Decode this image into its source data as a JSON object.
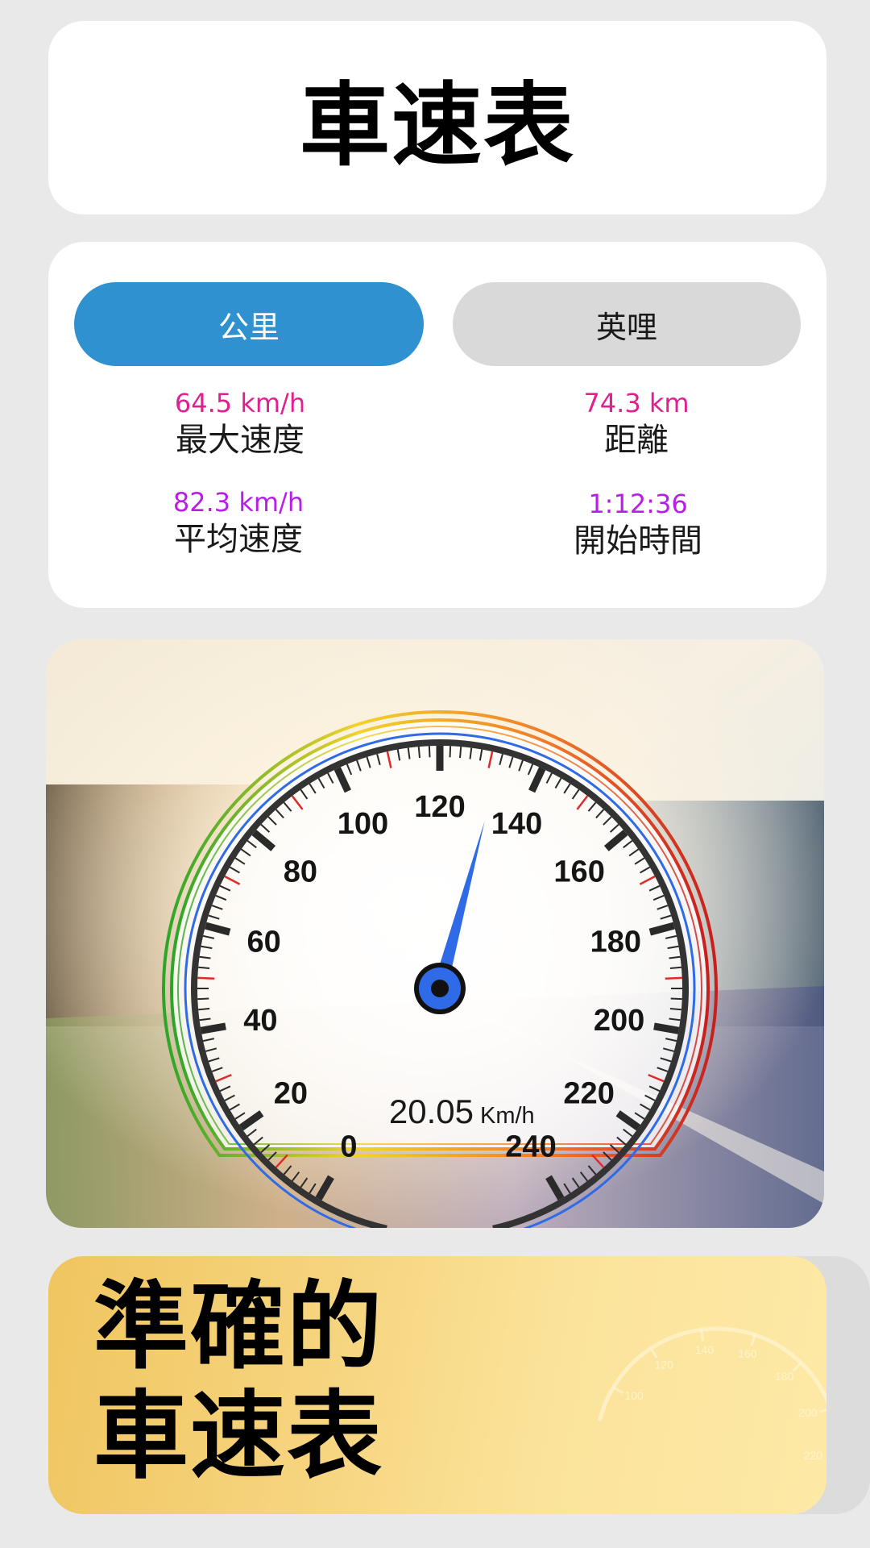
{
  "header": {
    "title": "車速表"
  },
  "units": {
    "active_tab": "公里",
    "inactive_tab": "英哩"
  },
  "stats": [
    {
      "value": "64.5 km/h",
      "label": "最大速度",
      "color": "#e0208f"
    },
    {
      "value": "74.3 km",
      "label": "距離",
      "color": "#e0208f"
    },
    {
      "value": "82.3 km/h",
      "label": "平均速度",
      "color": "#b81ee6"
    },
    {
      "value": "1:12:36",
      "label": "開始時間",
      "color": "#b81ee6"
    }
  ],
  "gauge": {
    "ticks": [
      "0",
      "20",
      "40",
      "60",
      "80",
      "100",
      "120",
      "140",
      "160",
      "180",
      "200",
      "220",
      "240"
    ],
    "needle_value": 132,
    "readout_value": "20.05",
    "readout_unit": "Km/h",
    "needle_color": "#2f6be6"
  },
  "promo": {
    "line1": "準確的",
    "line2": "車速表",
    "faded_ticks": [
      "100",
      "120",
      "140",
      "160",
      "180",
      "200",
      "220"
    ]
  }
}
